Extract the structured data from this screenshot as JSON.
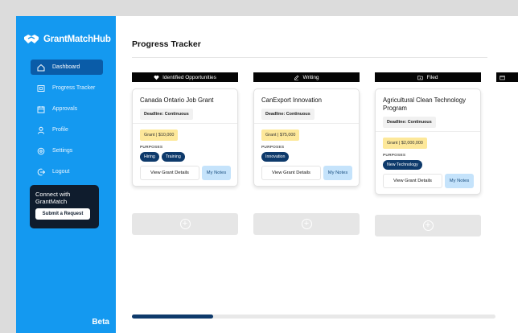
{
  "brand": {
    "name": "GrantMatchHub"
  },
  "sidebar": {
    "items": [
      {
        "label": "Dashboard",
        "icon": "home-icon",
        "active": true
      },
      {
        "label": "Progress Tracker",
        "icon": "tracker-icon",
        "active": false
      },
      {
        "label": "Approvals",
        "icon": "calendar-icon",
        "active": false
      },
      {
        "label": "Profile",
        "icon": "user-icon",
        "active": false
      },
      {
        "label": "Settings",
        "icon": "gear-icon",
        "active": false
      },
      {
        "label": "Logout",
        "icon": "logout-icon",
        "active": false
      }
    ],
    "connect": {
      "title": "Connect with GrantMatch",
      "button_label": "Submit a Request"
    },
    "beta_label": "Beta"
  },
  "main": {
    "title": "Progress Tracker",
    "columns": [
      {
        "label": "Identified Opportunities",
        "icon": "heart-icon",
        "card": {
          "title": "Canada Ontario Job Grant",
          "deadline": "Deadline: Continuous",
          "grant": "Grant | $10,000",
          "purposes_label": "PURPOSES",
          "purposes": [
            "Hiring",
            "Training"
          ],
          "details_label": "View Grant Details",
          "notes_label": "My Notes"
        }
      },
      {
        "label": "Writing",
        "icon": "pencil-icon",
        "card": {
          "title": "CanExport Innovation",
          "deadline": "Deadline: Continuous",
          "grant": "Grant | $75,000",
          "purposes_label": "PURPOSES",
          "purposes": [
            "Innovation"
          ],
          "details_label": "View Grant Details",
          "notes_label": "My Notes"
        }
      },
      {
        "label": "Filed",
        "icon": "folder-icon",
        "card": {
          "title": "Agricultural Clean Technology Program",
          "deadline": "Deadline: Continuous",
          "grant": "Grant | $2,000,000",
          "purposes_label": "PURPOSES",
          "purposes": [
            "New Technology"
          ],
          "details_label": "View Grant Details",
          "notes_label": "My Notes"
        }
      }
    ],
    "add_symbol": "+"
  },
  "colors": {
    "sidebar_bg": "#1499f0",
    "active_nav": "#0a5ca8",
    "tag_bg": "#0e3a6b",
    "grant_chip": "#fde89a",
    "notes_btn": "#c5e3fb",
    "column_header": "#050505"
  },
  "scrollbar": {
    "position_fraction": 0.0,
    "visible_fraction": 0.22
  }
}
